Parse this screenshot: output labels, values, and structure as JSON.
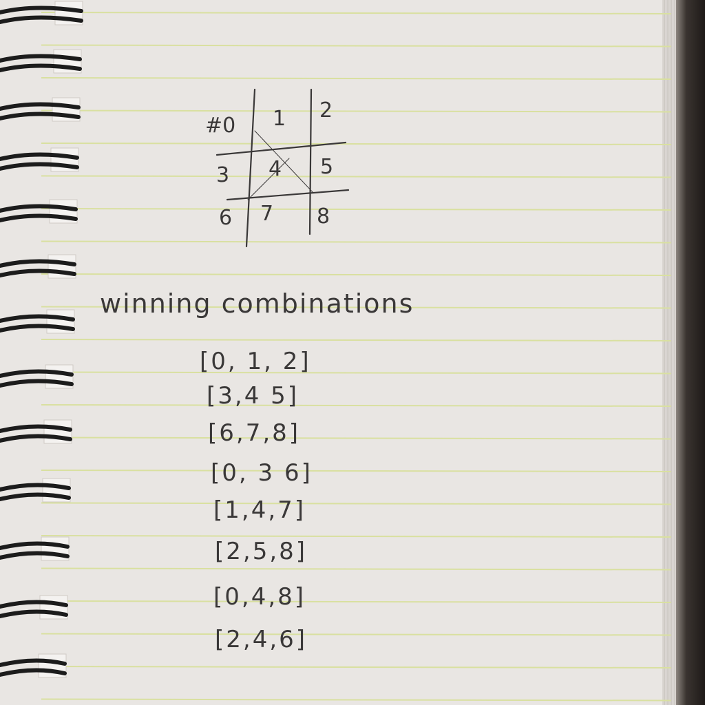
{
  "grid": {
    "cells": [
      "#0",
      "1",
      "2",
      "3",
      "4",
      "5",
      "6",
      "7",
      "8"
    ]
  },
  "heading": "winning combinations",
  "combinations": [
    "[0, 1, 2]",
    "[3,4 5]",
    "[6,7,8]",
    "[0, 3 6]",
    "[1,4,7]",
    "[2,5,8]",
    "[0,4,8]",
    "[2,4,6]"
  ],
  "colors": {
    "paper": "#e9e6e3",
    "rule": "#d9e0a0",
    "ink": "#3a3838",
    "spiral": "#1c1c1c"
  }
}
